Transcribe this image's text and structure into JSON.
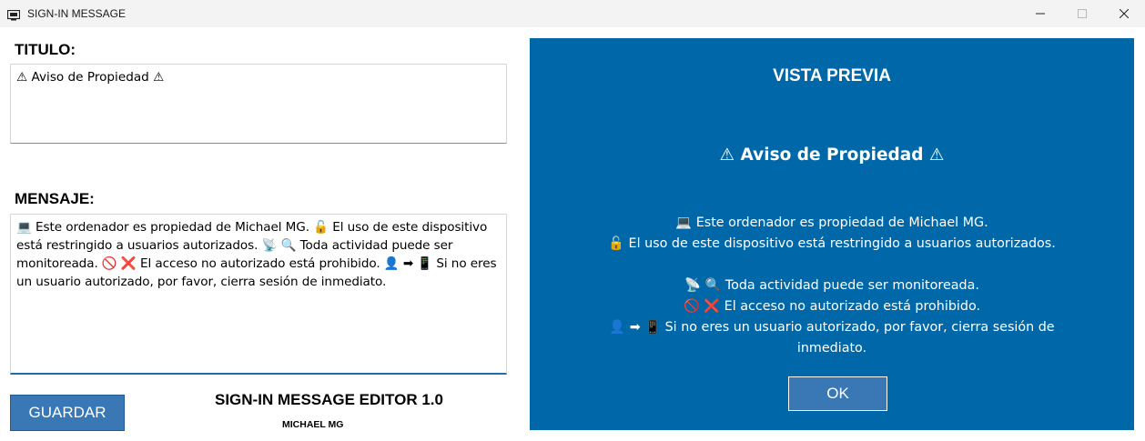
{
  "window": {
    "title": "SIGN-IN MESSAGE",
    "app_icon": "monitor-icon",
    "controls": [
      "minimize-icon",
      "maximize-icon",
      "close-icon"
    ]
  },
  "editor": {
    "title_label": "TITULO:",
    "title_value": "⚠ Aviso de Propiedad ⚠",
    "message_label": "MENSAJE:",
    "message_value": "💻 Este ordenador es propiedad de Michael MG. 🔓 El uso de este dispositivo está restringido a usuarios autorizados. 📡 🔍 Toda actividad puede ser monitoreada. 🚫 ❌ El acceso no autorizado está prohibido. 👤 ➡ 📱 Si no eres un usuario autorizado, por favor, cierra sesión de inmediato.",
    "save_label": "GUARDAR",
    "app_name": "SIGN-IN MESSAGE EDITOR 1.0",
    "author": "MICHAEL MG"
  },
  "preview": {
    "heading": "VISTA PREVIA",
    "title": "⚠ Aviso de Propiedad ⚠",
    "message": "💻 Este ordenador es propiedad de Michael MG.\n🔓 El uso de este dispositivo está restringido a usuarios autorizados.\n\n📡 🔍 Toda actividad puede ser monitoreada.\n🚫 ❌ El acceso no autorizado está prohibido.\n👤 ➡ 📱 Si no eres un usuario autorizado, por favor, cierra sesión de inmediato.",
    "ok_label": "OK"
  },
  "colors": {
    "preview_bg": "#0068a8",
    "button_bg": "#3a77b5",
    "accent_underline": "#1f6fb0",
    "titlebar_bg": "#f3f3f3"
  }
}
